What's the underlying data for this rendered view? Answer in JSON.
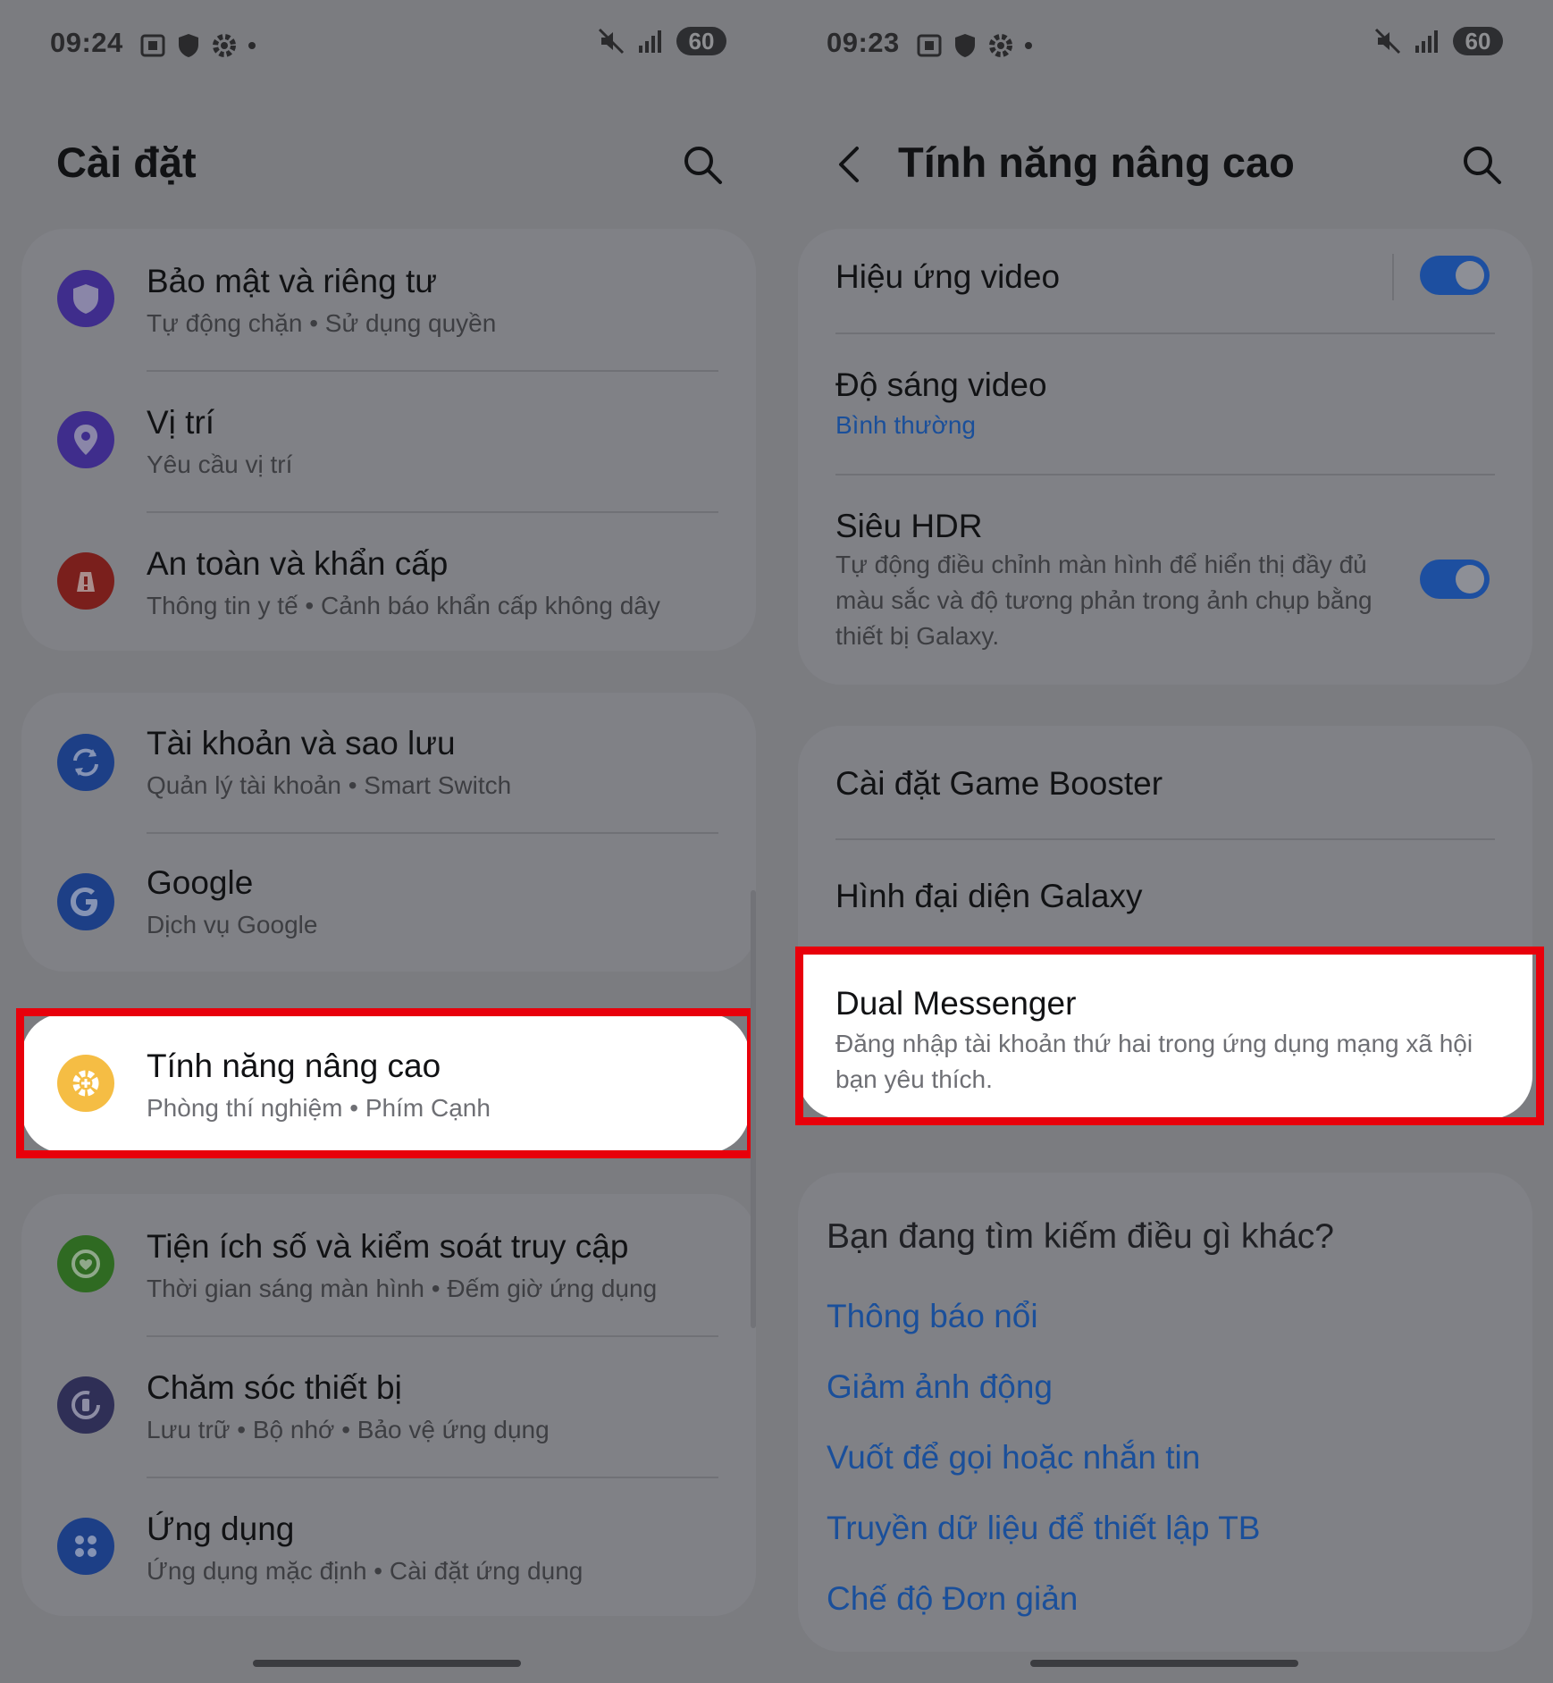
{
  "colors": {
    "highlight_border": "#e8000b",
    "accent": "#1d4fa0",
    "link": "#1a4f9a"
  },
  "left": {
    "status": {
      "time": "09:24",
      "battery": "60"
    },
    "title": "Cài đặt",
    "groups": [
      [
        {
          "icon": "shield-icon",
          "color": "#3f2d8c",
          "title": "Bảo mật và riêng tư",
          "subtitle": "Tự động chặn  •  Sử dụng quyền"
        },
        {
          "icon": "location-pin-icon",
          "color": "#3f2d8c",
          "title": "Vị trí",
          "subtitle": "Yêu cầu vị trí"
        },
        {
          "icon": "emergency-alert-icon",
          "color": "#7a1f1c",
          "title": "An toàn và khẩn cấp",
          "subtitle": "Thông tin y tế  •  Cảnh báo khẩn cấp không dây"
        }
      ],
      [
        {
          "icon": "sync-icon",
          "color": "#1d3f86",
          "title": "Tài khoản và sao lưu",
          "subtitle": "Quản lý tài khoản  •  Smart Switch"
        },
        {
          "icon": "google-icon",
          "color": "#1d3f86",
          "title": "Google",
          "subtitle": "Dịch vụ Google"
        }
      ],
      [
        {
          "icon": "advanced-features-icon",
          "color": "#f5bd44",
          "title": "Tính năng nâng cao",
          "subtitle": "Phòng thí nghiệm  •  Phím Cạnh"
        }
      ],
      [
        {
          "icon": "digital-wellbeing-icon",
          "color": "#2f6a22",
          "title": "Tiện ích số và kiểm soát truy cập",
          "subtitle": "Thời gian sáng màn hình  •  Đếm giờ ứng dụng"
        },
        {
          "icon": "device-care-icon",
          "color": "#2f2f56",
          "title": "Chăm sóc thiết bị",
          "subtitle": "Lưu trữ  •  Bộ nhớ  •  Bảo vệ ứng dụng"
        },
        {
          "icon": "apps-icon",
          "color": "#1d3f86",
          "title": "Ứng dụng",
          "subtitle": "Ứng dụng mặc định  •  Cài đặt ứng dụng"
        }
      ]
    ]
  },
  "right": {
    "status": {
      "time": "09:23",
      "battery": "60"
    },
    "title": "Tính năng nâng cao",
    "group1": [
      {
        "title": "Hiệu ứng video",
        "toggle": true
      },
      {
        "title": "Độ sáng video",
        "subtitle": "Bình thường"
      },
      {
        "title": "Siêu HDR",
        "subtitle": "Tự động điều chỉnh màn hình để hiển thị đầy đủ màu sắc và độ tương phản trong ảnh chụp bằng thiết bị Galaxy.",
        "toggle": true
      }
    ],
    "group2": [
      {
        "title": "Cài đặt Game Booster"
      },
      {
        "title": "Hình đại diện Galaxy"
      },
      {
        "title": "Dual Messenger",
        "subtitle": "Đăng nhập tài khoản thứ hai trong ứng dụng mạng xã hội bạn yêu thích."
      }
    ],
    "looking": {
      "title": "Bạn đang tìm kiếm điều gì khác?",
      "links": [
        "Thông báo nổi",
        "Giảm ảnh động",
        "Vuốt để gọi hoặc nhắn tin",
        "Truyền dữ liệu để thiết lập TB",
        "Chế độ Đơn giản"
      ]
    }
  }
}
